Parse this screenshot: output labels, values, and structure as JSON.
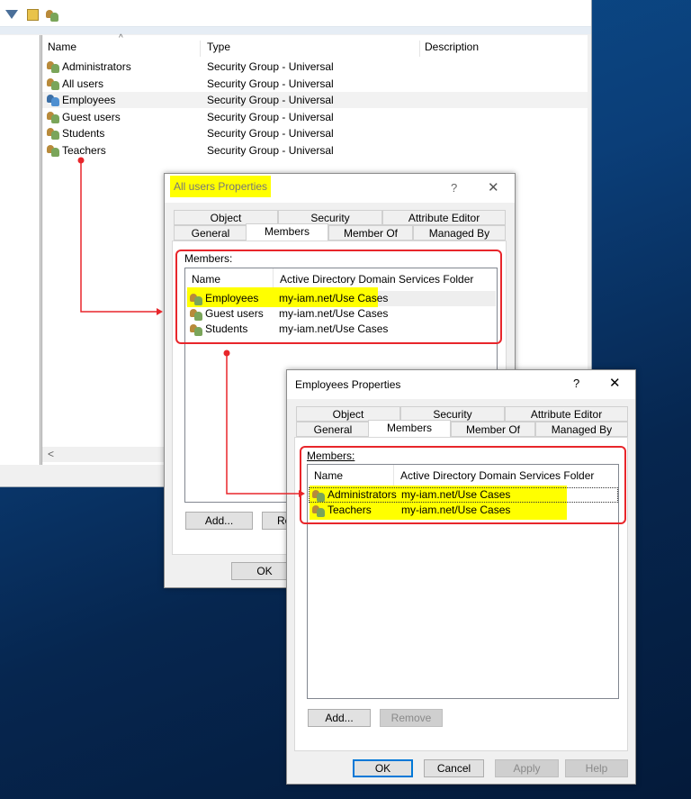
{
  "main_window": {
    "toolbar_icons": [
      "filter-icon",
      "find-icon",
      "add-to-group-icon"
    ],
    "columns": [
      "Name",
      "Type",
      "Description"
    ],
    "rows": [
      {
        "name": "Administrators",
        "type": "Security Group - Universal"
      },
      {
        "name": "All users",
        "type": "Security Group - Universal"
      },
      {
        "name": "Employees",
        "type": "Security Group - Universal"
      },
      {
        "name": "Guest users",
        "type": "Security Group - Universal"
      },
      {
        "name": "Students",
        "type": "Security Group - Universal"
      },
      {
        "name": "Teachers",
        "type": "Security Group - Universal"
      }
    ],
    "selected_row": "Employees",
    "scroll_left": "<"
  },
  "dialog1": {
    "title": "All users Properties",
    "help": "?",
    "close": "✕",
    "tabs_row1": [
      "Object",
      "Security",
      "Attribute Editor"
    ],
    "tabs_row2": [
      "General",
      "Members",
      "Member Of",
      "Managed By"
    ],
    "active_tab": "Members",
    "members_label": "Members:",
    "columns": [
      "Name",
      "Active Directory Domain Services Folder"
    ],
    "members": [
      {
        "name": "Employees",
        "folder": "my-iam.net/Use Cases"
      },
      {
        "name": "Guest users",
        "folder": "my-iam.net/Use Cases"
      },
      {
        "name": "Students",
        "folder": "my-iam.net/Use Cases"
      }
    ],
    "add": "Add...",
    "remove": "Rem",
    "ok": "OK"
  },
  "dialog2": {
    "title": "Employees Properties",
    "help": "?",
    "close": "✕",
    "tabs_row1": [
      "Object",
      "Security",
      "Attribute Editor"
    ],
    "tabs_row2": [
      "General",
      "Members",
      "Member Of",
      "Managed By"
    ],
    "active_tab": "Members",
    "members_label": "Members:",
    "columns": [
      "Name",
      "Active Directory Domain Services Folder"
    ],
    "members": [
      {
        "name": "Administrators",
        "folder": "my-iam.net/Use Cases"
      },
      {
        "name": "Teachers",
        "folder": "my-iam.net/Use Cases"
      }
    ],
    "add": "Add...",
    "remove": "Remove",
    "ok": "OK",
    "cancel": "Cancel",
    "apply": "Apply",
    "help_btn": "Help"
  },
  "colors": {
    "highlight": "#ffff00",
    "annotation": "#e8262b",
    "accent": "#0078d7"
  }
}
